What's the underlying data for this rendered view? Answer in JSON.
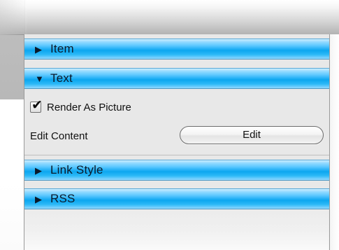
{
  "sections": {
    "item": {
      "label": "Item",
      "expanded": false,
      "icon": "disclosure-right-icon"
    },
    "text": {
      "label": "Text",
      "expanded": true,
      "icon": "disclosure-down-icon"
    },
    "link_style": {
      "label": "Link Style",
      "expanded": false,
      "icon": "disclosure-right-icon"
    },
    "rss": {
      "label": "RSS",
      "expanded": false,
      "icon": "disclosure-right-icon"
    }
  },
  "text_section": {
    "render_as_picture": {
      "label": "Render As Picture",
      "checked": true
    },
    "edit_content": {
      "label": "Edit Content",
      "button_label": "Edit"
    }
  },
  "glyphs": {
    "collapsed": "▶",
    "expanded": "▼",
    "check": "✔"
  },
  "colors": {
    "header_blue": "#22b0f5",
    "panel_gray": "#e8e8e8"
  }
}
